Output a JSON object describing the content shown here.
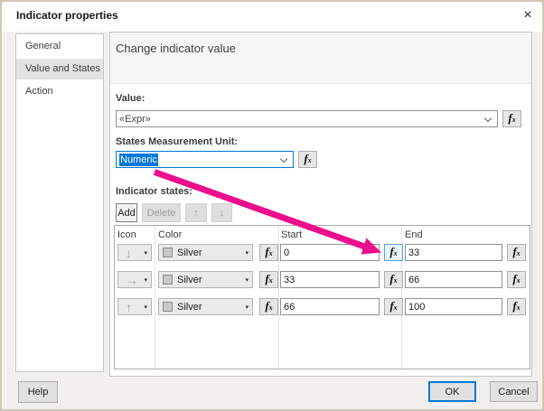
{
  "window": {
    "title": "Indicator properties"
  },
  "sidebar": {
    "items": [
      {
        "label": "General",
        "selected": false
      },
      {
        "label": "Value and States",
        "selected": true
      },
      {
        "label": "Action",
        "selected": false
      }
    ]
  },
  "main": {
    "heading": "Change indicator value",
    "value_field": {
      "label": "Value:",
      "value": "«Expr»"
    },
    "unit_field": {
      "label": "States Measurement Unit:",
      "value": "Numeric"
    },
    "states": {
      "label": "Indicator states:",
      "toolbar": {
        "add": "Add",
        "delete": "Delete"
      },
      "columns": [
        "Icon",
        "Color",
        "Start",
        "End"
      ],
      "rows": [
        {
          "icon": "arrow-down",
          "color": "Silver",
          "start": "0",
          "end": "33"
        },
        {
          "icon": "arrow-right",
          "color": "Silver",
          "start": "33",
          "end": "66"
        },
        {
          "icon": "arrow-up",
          "color": "Silver",
          "start": "66",
          "end": "100"
        }
      ]
    }
  },
  "footer": {
    "help": "Help",
    "ok": "OK",
    "cancel": "Cancel"
  },
  "icons": {
    "close": "×",
    "fx": "fx",
    "caret": "▾",
    "up": "↑",
    "down": "↓",
    "arrow_down": "↓",
    "arrow_right": "→",
    "arrow_up": "↑"
  },
  "colors": {
    "accent": "#0078d7",
    "selection": "#0078d7",
    "annotation_arrow": "#ec0c8e",
    "silver_swatch": "#c8c8c8",
    "dialog_border": "#d0c7b8"
  },
  "annotation": {
    "shape": "arrow",
    "color": "#ec0c8e",
    "points_from": "States Measurement Unit dropdown",
    "points_to": "Row 1 Start fx button"
  }
}
